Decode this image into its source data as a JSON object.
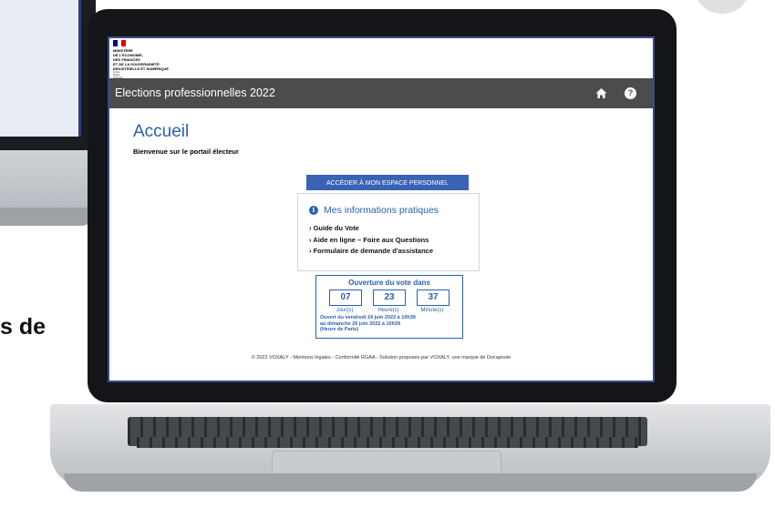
{
  "background": {
    "partial_text": "s de"
  },
  "header": {
    "ministry_lines": [
      "MINISTÈRE",
      "DE L'ÉCONOMIE,",
      "DES FINANCES",
      "ET DE LA SOUVERAINETÉ",
      "INDUSTRIELLE ET NUMÉRIQUE"
    ],
    "motto_lines": [
      "Liberté",
      "Égalité",
      "Fraternité"
    ]
  },
  "topbar": {
    "title": "Elections professionnelles 2022",
    "icons": [
      "home-icon",
      "help-icon"
    ],
    "help_glyph": "?"
  },
  "main": {
    "page_title": "Accueil",
    "welcome": "Bienvenue sur le portail électeur",
    "button_label": "ACCÉDER À MON ESPACE PERSONNEL"
  },
  "info_box": {
    "icon_glyph": "i",
    "title": "Mes informations pratiques",
    "links": [
      "› Guide du Vote",
      "› Aide en ligne – Foire aux Questions",
      "› Formulaire de demande d'assistance"
    ]
  },
  "countdown": {
    "title": "Ouverture du vote dans",
    "values": {
      "days": "07",
      "hours": "23",
      "minutes": "37"
    },
    "labels": {
      "days": "Jour(s)",
      "hours": "Heure(s)",
      "minutes": "Minute(s)"
    },
    "note_lines": [
      "Ouvert du vendredi 24 juin 2022 à 10h39",
      "au dimanche 26 juin 2022 à 10h39",
      "(Heure de Paris)"
    ]
  },
  "footer": {
    "text": "© 2022 VOXALY - Mentions légales - Conformité RGAA - Solution proposée par VOXALY, une marque de Docaposte"
  },
  "colors": {
    "accent": "#2a5fae",
    "button": "#3a62b5",
    "topbar": "#4c4c4c"
  }
}
